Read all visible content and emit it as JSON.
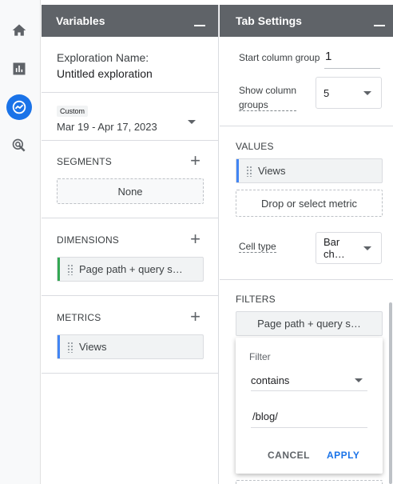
{
  "nav": {
    "items": [
      {
        "name": "home",
        "icon": "home-icon"
      },
      {
        "name": "reports",
        "icon": "bar-chart-icon"
      },
      {
        "name": "explore",
        "icon": "explore-icon",
        "active": true
      },
      {
        "name": "advertising",
        "icon": "advertising-icon"
      }
    ],
    "accent": "#1a73e8"
  },
  "variables": {
    "title": "Variables",
    "exploration_label": "Exploration Name:",
    "exploration_name": "Untitled exploration",
    "date_badge": "Custom",
    "date_range": "Mar 19 - Apr 17, 2023",
    "segments_title": "SEGMENTS",
    "segments_empty": "None",
    "dimensions_title": "DIMENSIONS",
    "dimension_item": "Page path + query s…",
    "dimension_color": "#34a853",
    "metrics_title": "METRICS",
    "metric_item": "Views",
    "metric_color": "#4285f4"
  },
  "tab_settings": {
    "title": "Tab Settings",
    "start_column_label": "Start column group",
    "start_column_value": "1",
    "show_column_label_1": "Show column",
    "show_column_label_2": "groups",
    "show_column_value": "5",
    "values_title": "VALUES",
    "values_item": "Views",
    "drop_metric": "Drop or select metric",
    "cell_type_label": "Cell type",
    "cell_type_value": "Bar ch…",
    "filters_title": "FILTERS",
    "filter_item": "Page path + query s…"
  },
  "filter_popup": {
    "label": "Filter",
    "operator": "contains",
    "value": "/blog/",
    "cancel": "CANCEL",
    "apply": "APPLY",
    "apply_color": "#1a73e8"
  }
}
